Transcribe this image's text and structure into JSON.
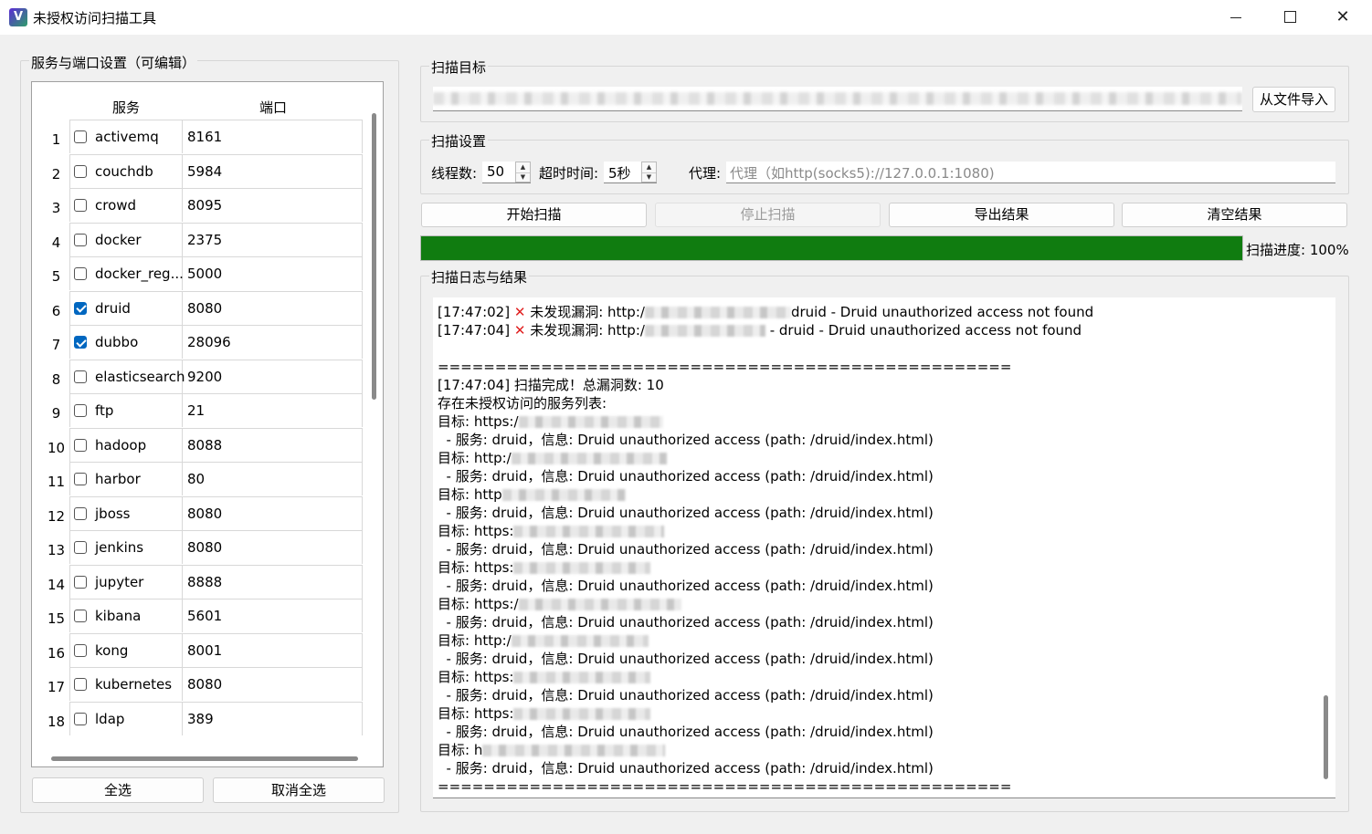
{
  "window": {
    "title": "未授权访问扫描工具",
    "icon_letter": "V"
  },
  "left_panel": {
    "group_title": "服务与端口设置（可编辑）",
    "columns": {
      "service": "服务",
      "port": "端口"
    },
    "rows": [
      {
        "num": "1",
        "service": "activemq",
        "port": "8161",
        "checked": false
      },
      {
        "num": "2",
        "service": "couchdb",
        "port": "5984",
        "checked": false
      },
      {
        "num": "3",
        "service": "crowd",
        "port": "8095",
        "checked": false
      },
      {
        "num": "4",
        "service": "docker",
        "port": "2375",
        "checked": false
      },
      {
        "num": "5",
        "service": "docker_reg...",
        "port": "5000",
        "checked": false
      },
      {
        "num": "6",
        "service": "druid",
        "port": "8080",
        "checked": true
      },
      {
        "num": "7",
        "service": "dubbo",
        "port": "28096",
        "checked": true
      },
      {
        "num": "8",
        "service": "elasticsearch",
        "port": "9200",
        "checked": false
      },
      {
        "num": "9",
        "service": "ftp",
        "port": "21",
        "checked": false
      },
      {
        "num": "10",
        "service": "hadoop",
        "port": "8088",
        "checked": false
      },
      {
        "num": "11",
        "service": "harbor",
        "port": "80",
        "checked": false
      },
      {
        "num": "12",
        "service": "jboss",
        "port": "8080",
        "checked": false
      },
      {
        "num": "13",
        "service": "jenkins",
        "port": "8080",
        "checked": false
      },
      {
        "num": "14",
        "service": "jupyter",
        "port": "8888",
        "checked": false
      },
      {
        "num": "15",
        "service": "kibana",
        "port": "5601",
        "checked": false
      },
      {
        "num": "16",
        "service": "kong",
        "port": "8001",
        "checked": false
      },
      {
        "num": "17",
        "service": "kubernetes",
        "port": "8080",
        "checked": false
      },
      {
        "num": "18",
        "service": "ldap",
        "port": "389",
        "checked": false
      }
    ],
    "select_all": "全选",
    "deselect_all": "取消全选"
  },
  "target": {
    "group_title": "扫描目标",
    "import_button": "从文件导入"
  },
  "settings": {
    "group_title": "扫描设置",
    "threads_label": "线程数:",
    "threads_value": "50",
    "timeout_label": "超时时间:",
    "timeout_value": "5秒",
    "proxy_label": "代理:",
    "proxy_placeholder": "代理（如http(socks5)://127.0.0.1:1080)"
  },
  "actions": {
    "start": "开始扫描",
    "stop": "停止扫描",
    "export": "导出结果",
    "clear": "清空结果"
  },
  "progress": {
    "label": "扫描进度: 100%",
    "percent": 100,
    "color": "#107c10"
  },
  "log": {
    "group_title": "扫描日志与结果",
    "lines": [
      {
        "kind": "cut"
      },
      {
        "kind": "fail",
        "time": "[17:47:02]",
        "text": "未发现漏洞: http:/",
        "blur_w": 160,
        "tail": "druid - Druid unauthorized access not found"
      },
      {
        "kind": "fail",
        "time": "[17:47:04]",
        "text": "未发现漏洞: http:/",
        "blur_w": 132,
        "tail": " - druid - Druid unauthorized access not found"
      },
      {
        "kind": "text",
        "text": ""
      },
      {
        "kind": "text",
        "text": "=================================================="
      },
      {
        "kind": "text",
        "text": "[17:47:04] 扫描完成！总漏洞数: 10"
      },
      {
        "kind": "text",
        "text": "存在未授权访问的服务列表:"
      },
      {
        "kind": "target",
        "text": "目标: https:/",
        "blur_w": 158
      },
      {
        "kind": "text",
        "text": "  - 服务: druid，信息: Druid unauthorized access (path: /druid/index.html)"
      },
      {
        "kind": "target",
        "text": "目标: http:/",
        "blur_w": 170
      },
      {
        "kind": "text",
        "text": "  - 服务: druid，信息: Druid unauthorized access (path: /druid/index.html)"
      },
      {
        "kind": "target",
        "text": "目标: http",
        "blur_w": 135
      },
      {
        "kind": "text",
        "text": "  - 服务: druid，信息: Druid unauthorized access (path: /druid/index.html)"
      },
      {
        "kind": "target",
        "text": "目标: https:",
        "blur_w": 165
      },
      {
        "kind": "text",
        "text": "  - 服务: druid，信息: Druid unauthorized access (path: /druid/index.html)"
      },
      {
        "kind": "target",
        "text": "目标: https:",
        "blur_w": 150
      },
      {
        "kind": "text",
        "text": "  - 服务: druid，信息: Druid unauthorized access (path: /druid/index.html)"
      },
      {
        "kind": "target",
        "text": "目标: https:/",
        "blur_w": 178
      },
      {
        "kind": "text",
        "text": "  - 服务: druid，信息: Druid unauthorized access (path: /druid/index.html)"
      },
      {
        "kind": "target",
        "text": "目标: http:/",
        "blur_w": 150
      },
      {
        "kind": "text",
        "text": "  - 服务: druid，信息: Druid unauthorized access (path: /druid/index.html)"
      },
      {
        "kind": "target",
        "text": "目标: https:",
        "blur_w": 150
      },
      {
        "kind": "text",
        "text": "  - 服务: druid，信息: Druid unauthorized access (path: /druid/index.html)"
      },
      {
        "kind": "target",
        "text": "目标: https:",
        "blur_w": 150
      },
      {
        "kind": "text",
        "text": "  - 服务: druid，信息: Druid unauthorized access (path: /druid/index.html)"
      },
      {
        "kind": "target",
        "text": "目标: h",
        "blur_w": 200
      },
      {
        "kind": "text",
        "text": "  - 服务: druid，信息: Druid unauthorized access (path: /druid/index.html)"
      },
      {
        "kind": "text",
        "text": "=================================================="
      }
    ]
  }
}
